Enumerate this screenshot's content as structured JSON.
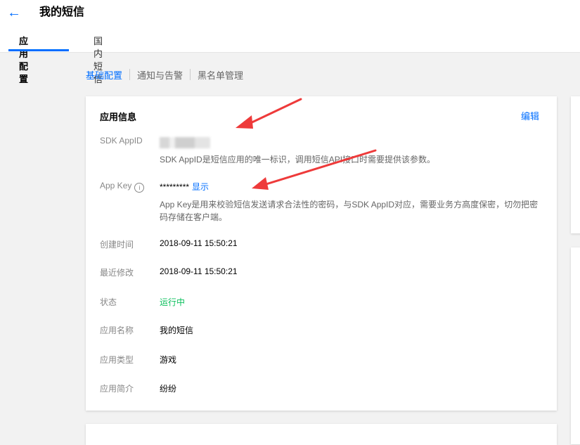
{
  "header": {
    "back_icon": "arrow-left-icon",
    "title": "我的短信"
  },
  "tabs": [
    {
      "label": "应用配置",
      "active": true
    },
    {
      "label": "国内短信",
      "active": false
    }
  ],
  "subnav": [
    {
      "label": "基础配置",
      "active": true
    },
    {
      "label": "通知与告警"
    },
    {
      "label": "黑名单管理"
    }
  ],
  "card": {
    "title": "应用信息",
    "edit_label": "编辑",
    "sdk_appid": {
      "label": "SDK AppID",
      "note": "SDK AppID是短信应用的唯一标识，调用短信API接口时需要提供该参数。"
    },
    "app_key": {
      "label": "App Key",
      "value": "*********",
      "show_label": "显示",
      "note": "App Key是用来校验短信发送请求合法性的密码，与SDK AppID对应，需要业务方高度保密，切勿把密码存储在客户端。"
    },
    "created": {
      "label": "创建时间",
      "value": "2018-09-11 15:50:21"
    },
    "modified": {
      "label": "最近修改",
      "value": "2018-09-11 15:50:21"
    },
    "status": {
      "label": "状态",
      "value": "运行中",
      "color": "#0abf5b"
    },
    "app_name": {
      "label": "应用名称",
      "value": "我的短信"
    },
    "app_type": {
      "label": "应用类型",
      "value": "游戏"
    },
    "app_desc": {
      "label": "应用简介",
      "value": "纷纷"
    }
  },
  "colors": {
    "accent": "#006eff",
    "annotation_arrow": "#ee3a3a"
  }
}
